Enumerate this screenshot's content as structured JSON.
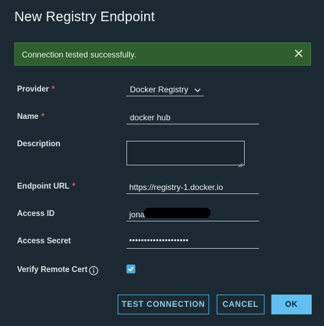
{
  "dialog": {
    "title": "New Registry Endpoint"
  },
  "alert": {
    "message": "Connection tested successfully.",
    "close_icon": "close-icon"
  },
  "form": {
    "provider": {
      "label": "Provider",
      "required_mark": "*",
      "value": "Docker Registry"
    },
    "name": {
      "label": "Name",
      "required_mark": "*",
      "value": "docker hub"
    },
    "description": {
      "label": "Description",
      "value": ""
    },
    "endpoint_url": {
      "label": "Endpoint URL",
      "required_mark": "*",
      "value": "https://registry-1.docker.io"
    },
    "access_id": {
      "label": "Access ID",
      "value": "jona"
    },
    "access_secret": {
      "label": "Access Secret",
      "value": "••••••••••••••••••••"
    },
    "verify_remote_cert": {
      "label": "Verify Remote Cert",
      "checked": true
    }
  },
  "buttons": {
    "test_connection": "TEST CONNECTION",
    "cancel": "CANCEL",
    "ok": "OK"
  },
  "colors": {
    "background": "#1b2a32",
    "alert_bg": "#2f5f2e",
    "accent": "#4aa8dd",
    "primary_button": "#63bff0",
    "required": "#e35d5d"
  }
}
